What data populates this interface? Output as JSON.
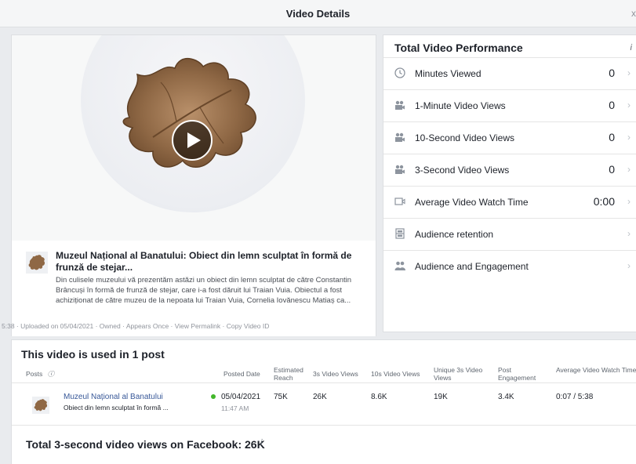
{
  "window": {
    "title": "Video Details",
    "close": "x"
  },
  "video": {
    "duration": "5:38",
    "uploaded": "Uploaded on 05/04/2021",
    "owned": "Owned",
    "appears": "Appears Once",
    "permalink": "View Permalink",
    "copy_id": "Copy Video ID"
  },
  "post": {
    "name": "Muzeul Național al Banatului: Obiect din lemn sculptat în formă de frunză de stejar...",
    "description": "Din culisele muzeului vă prezentăm astăzi un obiect din lemn sculptat de către Constantin Brâncuși în formă de frunză de stejar, care i-a fost dăruit lui Traian Vuia. Obiectul a fost achiziționat de către muzeu de la nepoata lui Traian Vuia, Cornelia Iovănescu Matiaș ca..."
  },
  "performance": {
    "title": "Total Video Performance",
    "info": "i",
    "metrics": [
      {
        "label": "Minutes Viewed",
        "value": "0",
        "icon": "clock-icon"
      },
      {
        "label": "1-Minute Video Views",
        "value": "0",
        "icon": "camera-icon"
      },
      {
        "label": "10-Second Video Views",
        "value": "0",
        "icon": "camera-icon"
      },
      {
        "label": "3-Second Video Views",
        "value": "0",
        "icon": "camera-icon"
      },
      {
        "label": "Average Video Watch Time",
        "value": "0:00",
        "icon": "video-icon"
      },
      {
        "label": "Audience retention",
        "value": "",
        "icon": "film-icon"
      },
      {
        "label": "Audience and Engagement",
        "value": "",
        "icon": "people-icon"
      }
    ],
    "chevron": "›"
  },
  "usage": {
    "title": "This video is used in 1 post",
    "columns": [
      "Posts",
      "Posted Date",
      "Estimated Reach",
      "3s Video Views",
      "10s Video Views",
      "Unique 3s Video Views",
      "Post Engagement",
      "Average Video Watch Time"
    ],
    "row": {
      "name": "Muzeul Național al Banatului",
      "sub": "Obiect din lemn sculptat în formă ...",
      "date": "05/04/2021",
      "time": "11:47 AM",
      "reach": "75K",
      "views3s": "26K",
      "views10s": "8.6K",
      "unique3s": "19K",
      "engagement": "3.4K",
      "avgwatch": "0:07 / 5:38"
    },
    "total": "Total 3-second video views on Facebook: 26K"
  },
  "colors": {
    "link": "#385898",
    "live_dot": "#42b72a"
  }
}
